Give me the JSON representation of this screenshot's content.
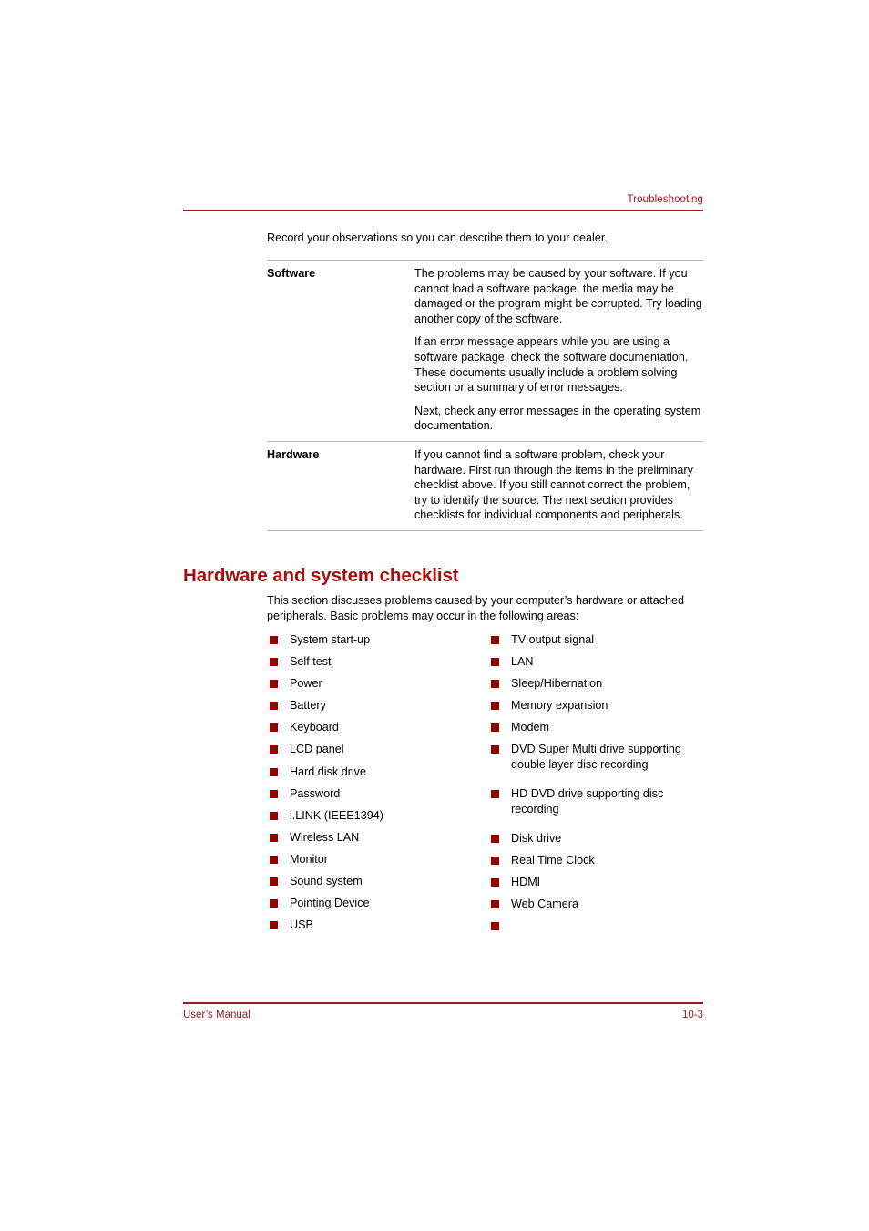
{
  "header": {
    "chapter_title": "Troubleshooting"
  },
  "intro": {
    "text": "Record your observations so you can describe them to your dealer."
  },
  "table": {
    "rows": [
      {
        "term": "Software",
        "paragraphs": [
          "The problems may be caused by your software. If you cannot load a software package, the media may be damaged or the program might be corrupted. Try loading another copy of the software.",
          "If an error message appears while you are using a software package, check the software documentation. These documents usually include a problem solving section or a summary of error messages.",
          "Next, check any error messages in the operating system documentation."
        ]
      },
      {
        "term": "Hardware",
        "paragraphs": [
          "If you cannot find a software problem, check your hardware. First run through the items in the preliminary checklist above. If you still cannot correct the problem, try to identify the source. The next section provides checklists for individual components and peripherals."
        ]
      }
    ]
  },
  "section": {
    "heading": "Hardware and system checklist",
    "intro": "This section discusses problems caused by your computer’s hardware or attached peripherals. Basic problems may occur in the following areas:"
  },
  "checklist": {
    "left_column": [
      "System start-up",
      "Self test",
      "Power",
      "Battery",
      "Keyboard",
      "LCD panel",
      "Hard disk drive",
      "Password",
      "i.LINK (IEEE1394)",
      "Wireless LAN",
      "Monitor",
      "Sound system",
      "Pointing Device",
      "USB"
    ],
    "right_column": [
      "TV output signal",
      "LAN",
      "Sleep/Hibernation",
      "Memory expansion",
      "Modem",
      "DVD Super Multi drive supporting double layer disc recording",
      "HD DVD drive supporting disc recording",
      "Disk drive",
      "Real Time Clock",
      "HDMI",
      "Web Camera",
      ""
    ]
  },
  "footer": {
    "manual_label": "User’s Manual",
    "page_number": "10-3"
  },
  "colors": {
    "accent_red": "#A01520",
    "heading_red": "#A30F0F",
    "bullet_red": "#990000",
    "rule_red": "#9B1B1B",
    "table_rule_gray": "#b9b9b9"
  }
}
